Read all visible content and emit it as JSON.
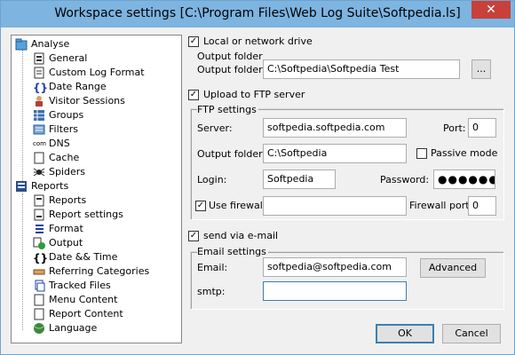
{
  "window": {
    "title": "Workspace settings [C:\\Program Files\\Web Log Suite\\Softpedia.ls]",
    "close_glyph": "✕"
  },
  "tree": {
    "analyse": {
      "label": "Analyse",
      "children": [
        "General",
        "Custom Log Format",
        "Date Range",
        "Visitor Sessions",
        "Groups",
        "Filters",
        "DNS",
        "Cache",
        "Spiders"
      ]
    },
    "reports": {
      "label": "Reports",
      "children": [
        "Reports",
        "Report settings",
        "Format",
        "Output",
        "Date && Time",
        "Referring Categories",
        "Tracked Files",
        "Menu Content",
        "Report Content",
        "Language"
      ]
    }
  },
  "local": {
    "checkbox_label": "Local or network drive",
    "checked": true,
    "group_label": "Output folder",
    "output_folder_label": "Output folder:",
    "output_folder_value": "C:\\Softpedia\\Softpedia Test",
    "browse_label": "..."
  },
  "ftp": {
    "checkbox_label": "Upload to FTP server",
    "checked": true,
    "group_label": "FTP settings",
    "server_label": "Server:",
    "server_value": "softpedia.softpedia.com",
    "port_label": "Port:",
    "port_value": "0",
    "output_folder_label": "Output folder:",
    "output_folder_value": "C:\\Softpedia",
    "passive_label": "Passive mode",
    "passive_checked": false,
    "login_label": "Login:",
    "login_value": "Softpedia",
    "password_label": "Password:",
    "password_value": "●●●●●●●",
    "firewall_label": "Use firewall",
    "firewall_checked": true,
    "firewall_value": "",
    "firewall_port_label": "Firewall port:",
    "firewall_port_value": "0"
  },
  "email": {
    "checkbox_label": "send via e-mail",
    "checked": true,
    "group_label": "Email settings",
    "email_label": "Email:",
    "email_value": "softpedia@softpedia.com",
    "advanced_label": "Advanced",
    "smtp_label": "smtp:",
    "smtp_value": ""
  },
  "buttons": {
    "ok": "OK",
    "cancel": "Cancel"
  }
}
